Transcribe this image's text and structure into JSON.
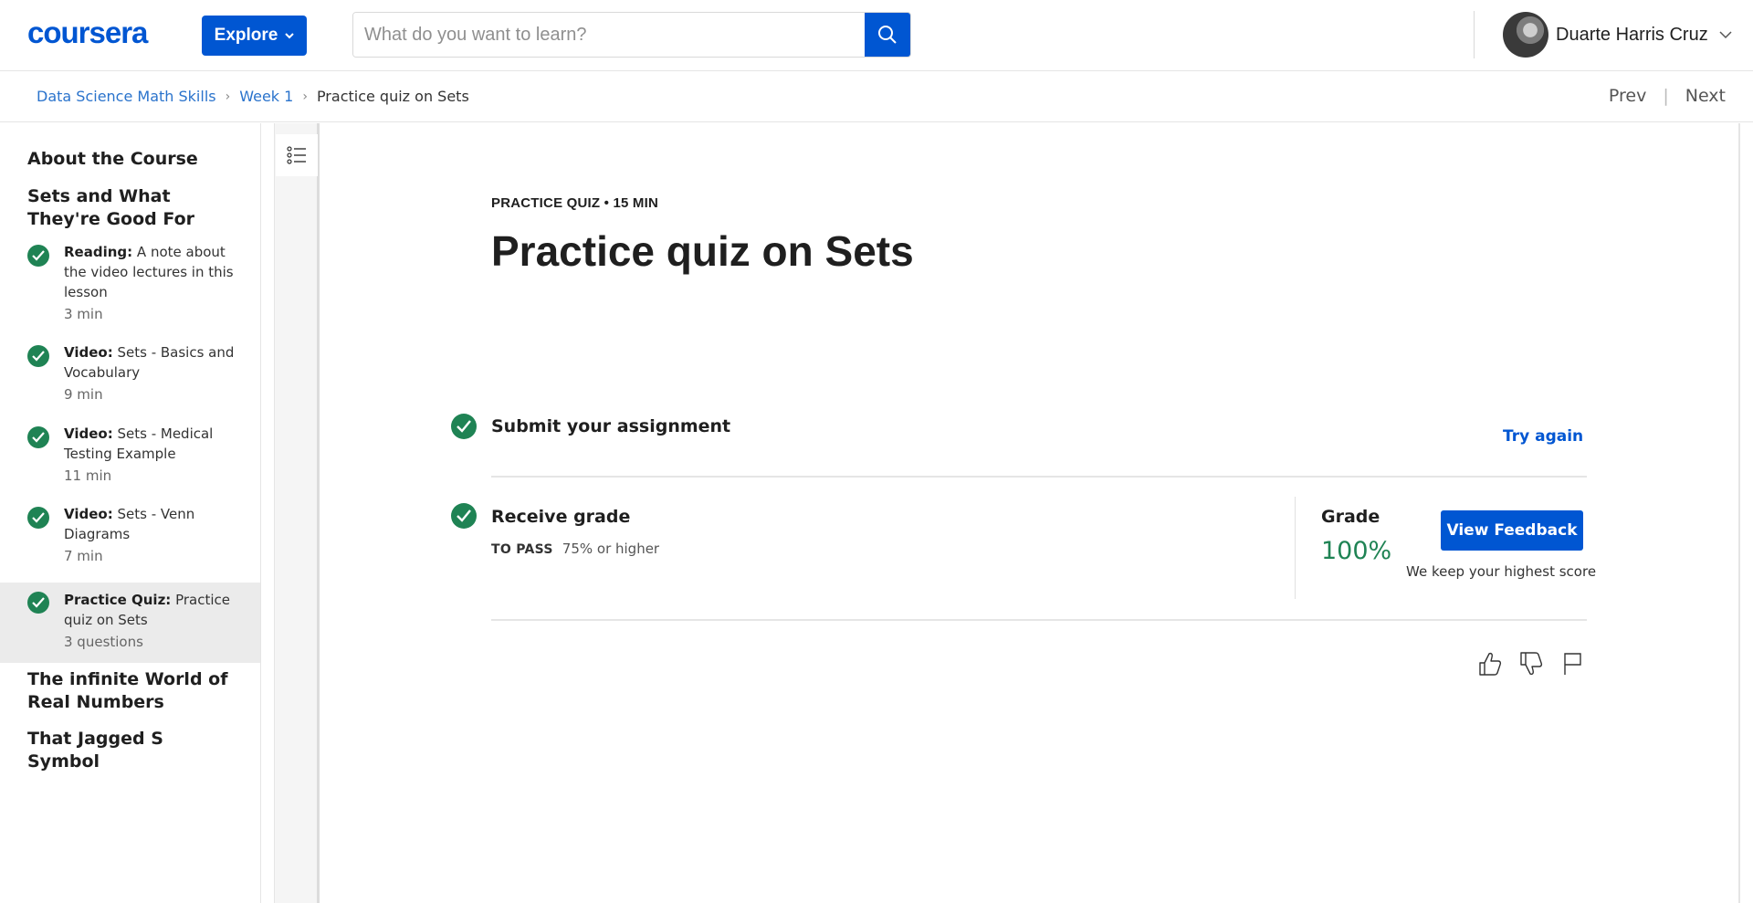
{
  "header": {
    "logo_text": "coursera",
    "explore_label": "Explore",
    "search_placeholder": "What do you want to learn?",
    "user_name": "Duarte Harris Cruz"
  },
  "breadcrumb": {
    "items": [
      "Data Science Math Skills",
      "Week 1"
    ],
    "current": "Practice quiz on Sets"
  },
  "nav": {
    "prev": "Prev",
    "next": "Next"
  },
  "sidebar": {
    "headings": [
      "About the Course",
      "Sets and What They're Good For",
      "The infinite World of Real Numbers",
      "That Jagged S Symbol"
    ],
    "items": [
      {
        "type": "Reading:",
        "title": "A note about the video lectures in this lesson",
        "meta": "3 min"
      },
      {
        "type": "Video:",
        "title": "Sets - Basics and Vocabulary",
        "meta": "9 min"
      },
      {
        "type": "Video:",
        "title": "Sets - Medical Testing Example",
        "meta": "11 min"
      },
      {
        "type": "Video:",
        "title": "Sets - Venn Diagrams",
        "meta": "7 min"
      },
      {
        "type": "Practice Quiz:",
        "title": "Practice quiz on Sets",
        "meta": "3 questions"
      }
    ]
  },
  "main": {
    "eyebrow": "PRACTICE QUIZ • 15 MIN",
    "title": "Practice quiz on Sets",
    "submit": {
      "title": "Submit your assignment",
      "action": "Try again"
    },
    "receive": {
      "title": "Receive grade",
      "to_pass_label": "TO PASS",
      "to_pass_value": "75% or higher",
      "grade_label": "Grade",
      "grade_value": "100%",
      "feedback_button": "View Feedback",
      "note": "We keep your highest score"
    }
  },
  "colors": {
    "primary": "#0056d2",
    "success": "#1f8354",
    "link": "#2a73cc"
  }
}
